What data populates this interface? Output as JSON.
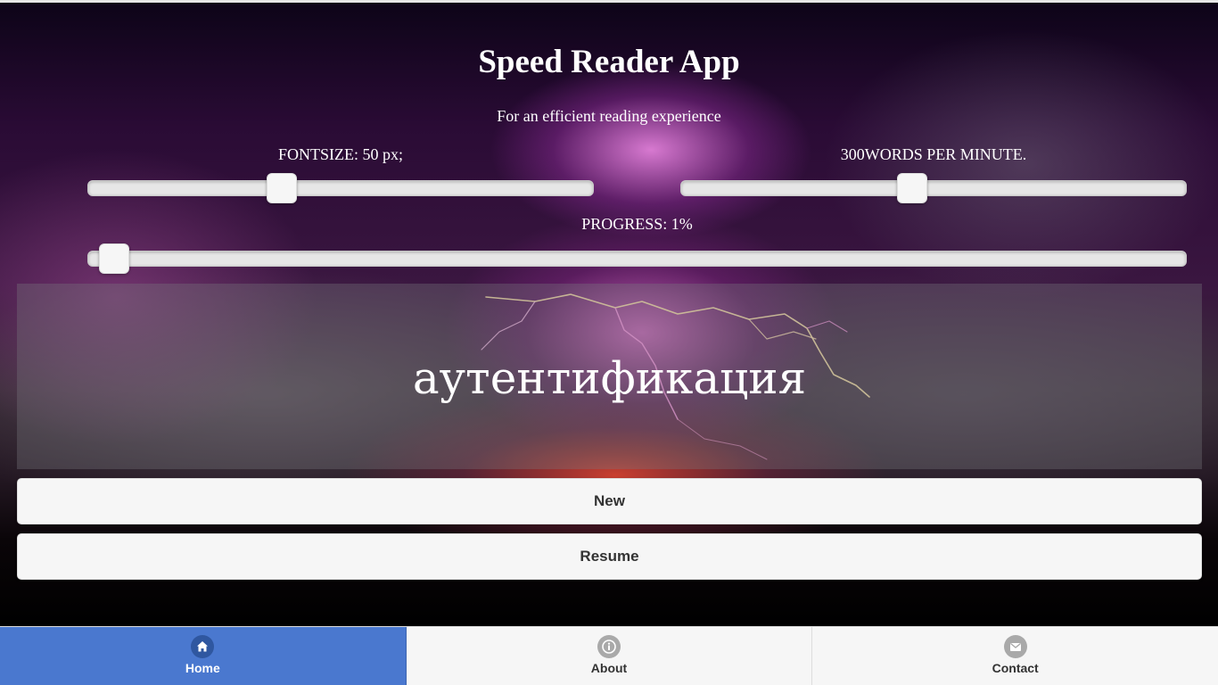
{
  "app": {
    "title": "Speed Reader App",
    "subtitle": "For an efficient reading experience"
  },
  "controls": {
    "fontsize": {
      "label": "FONTSIZE: 50 px;",
      "value_fraction": 0.375
    },
    "wpm": {
      "label": "300WORDS PER MINUTE.",
      "value_fraction": 0.455
    },
    "progress": {
      "label": "PROGRESS: 1%",
      "value_fraction": 0.01
    }
  },
  "reader": {
    "current_word": "аутентификация"
  },
  "buttons": {
    "new_label": "New",
    "resume_label": "Resume"
  },
  "navbar": {
    "items": [
      {
        "label": "Home",
        "icon": "home-icon",
        "active": true
      },
      {
        "label": "About",
        "icon": "info-icon",
        "active": false
      },
      {
        "label": "Contact",
        "icon": "mail-icon",
        "active": false
      }
    ]
  },
  "colors": {
    "nav_active": "#4a78cf",
    "button_bg": "#f6f6f6",
    "text_light": "#ffffff",
    "text_dark": "#333333"
  }
}
